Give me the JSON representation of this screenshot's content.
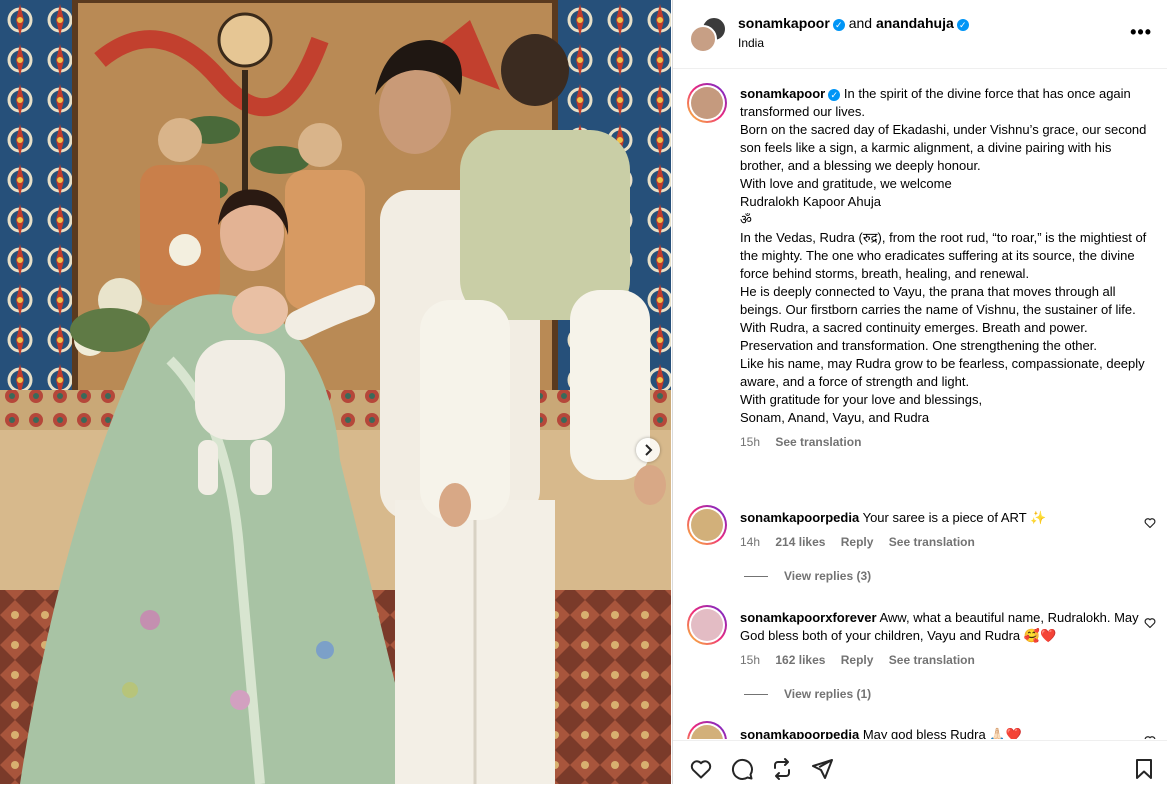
{
  "header": {
    "user1": "sonamkapoor",
    "and_text": "and",
    "user2": "anandahuja",
    "location": "India",
    "more": "•••"
  },
  "caption": {
    "username": "sonamkapoor",
    "lines": [
      "In the spirit of the divine force that has once again transformed our lives.",
      "Born on the sacred day of Ekadashi, under Vishnu’s grace, our second son feels like a sign, a karmic alignment, a divine pairing with his brother, and a blessing we deeply honour.",
      "With love and gratitude, we welcome",
      "Rudralokh Kapoor Ahuja",
      "ॐ",
      "In the Vedas, Rudra (रुद्र), from the root rud, “to roar,” is the mightiest of the mighty. The one who eradicates suffering at its source, the divine force behind storms, breath, healing, and renewal.",
      "He is deeply connected to Vayu, the prana that moves through all beings. Our firstborn carries the name of Vishnu, the sustainer of life. With Rudra, a sacred continuity emerges. Breath and power. Preservation and transformation. One strengthening the other.",
      "Like his name, may Rudra grow to be fearless, compassionate, deeply aware, and a force of strength and light.",
      "With gratitude for your love and blessings,",
      "Sonam, Anand, Vayu, and Rudra"
    ],
    "time": "15h",
    "see_translation": "See translation"
  },
  "comments": [
    {
      "username": "sonamkapoorpedia",
      "text": "Your saree is a piece of ART ✨",
      "time": "14h",
      "likes": "214 likes",
      "reply": "Reply",
      "see_translation": "See translation",
      "view_replies": "View replies (3)"
    },
    {
      "username": "sonamkapoorxforever",
      "text": "Aww, what a beautiful name, Rudralokh. May God bless both of your children, Vayu and Rudra 🥰❤️",
      "time": "15h",
      "likes": "162 likes",
      "reply": "Reply",
      "see_translation": "See translation",
      "view_replies": "View replies (1)"
    },
    {
      "username": "sonamkapoorpedia",
      "text": "May god bless Rudra 🙏🏻❤️"
    }
  ],
  "icons": {
    "like": "heart-icon",
    "comment": "comment-icon",
    "repost": "repost-icon",
    "share": "share-icon",
    "save": "bookmark-icon",
    "carousel_next": "chevron-right-icon"
  },
  "colors": {
    "verified": "#0095f6",
    "secondary_text": "#737373",
    "border": "#dbdbdb"
  }
}
